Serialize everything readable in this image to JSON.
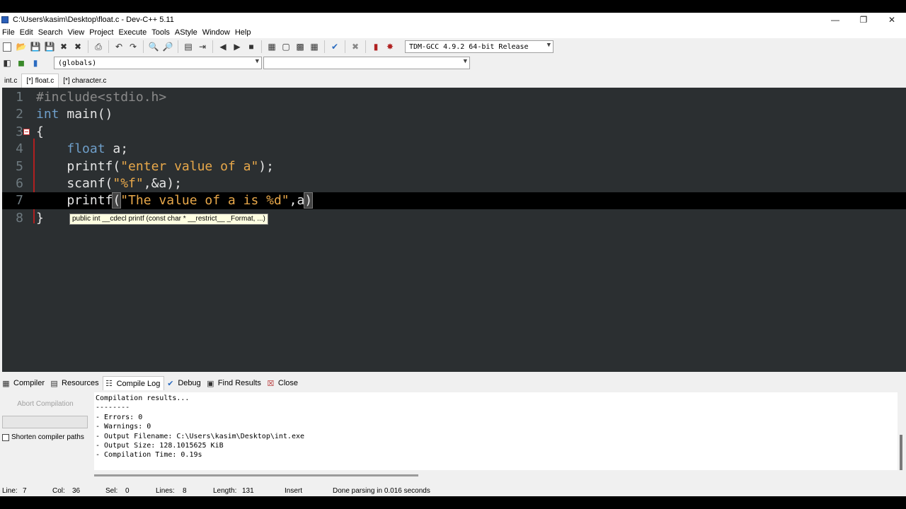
{
  "window": {
    "title": "C:\\Users\\kasim\\Desktop\\float.c - Dev-C++ 5.11",
    "controls": [
      "minimize",
      "restore",
      "close"
    ]
  },
  "menu": [
    "File",
    "Edit",
    "Search",
    "View",
    "Project",
    "Execute",
    "Tools",
    "AStyle",
    "Window",
    "Help"
  ],
  "toolbar": {
    "compiler_select": "TDM-GCC 4.9.2 64-bit Release",
    "scope_select": "(globals)",
    "function_select": ""
  },
  "tabs": [
    "int.c",
    "[*] float.c",
    "[*] character.c"
  ],
  "active_tab": "[*] float.c",
  "editor": {
    "lines": [
      {
        "n": "1",
        "parts": [
          {
            "t": "#include<stdio.h>",
            "c": "pp"
          }
        ]
      },
      {
        "n": "2",
        "parts": [
          {
            "t": "int",
            "c": "kw"
          },
          {
            "t": " main()",
            "c": ""
          }
        ]
      },
      {
        "n": "3",
        "parts": [
          {
            "t": "{",
            "c": ""
          }
        ]
      },
      {
        "n": "4",
        "parts": [
          {
            "t": "    ",
            "c": ""
          },
          {
            "t": "float",
            "c": "kw"
          },
          {
            "t": " a;",
            "c": ""
          }
        ]
      },
      {
        "n": "5",
        "parts": [
          {
            "t": "    printf(",
            "c": ""
          },
          {
            "t": "\"enter value of a\"",
            "c": "str"
          },
          {
            "t": ");",
            "c": ""
          }
        ]
      },
      {
        "n": "6",
        "parts": [
          {
            "t": "    scanf(",
            "c": ""
          },
          {
            "t": "\"%f\"",
            "c": "str"
          },
          {
            "t": ",&a);",
            "c": ""
          }
        ]
      },
      {
        "n": "7",
        "parts": [
          {
            "t": "    printf",
            "c": ""
          },
          {
            "t": "(",
            "c": "hl"
          },
          {
            "t": "\"The value of a is %d\"",
            "c": "str"
          },
          {
            "t": ",a",
            "c": ""
          },
          {
            "t": ")",
            "c": "hl"
          }
        ]
      },
      {
        "n": "8",
        "parts": [
          {
            "t": "}",
            "c": ""
          }
        ]
      }
    ],
    "current_line": "7",
    "tooltip": "public int __cdecl printf (const char * __restrict__ _Format, ...)"
  },
  "bottom_tabs": [
    {
      "label": "Compiler",
      "icon": "grid-icon"
    },
    {
      "label": "Resources",
      "icon": "resources-icon"
    },
    {
      "label": "Compile Log",
      "icon": "chart-icon"
    },
    {
      "label": "Debug",
      "icon": "check-icon"
    },
    {
      "label": "Find Results",
      "icon": "find-icon"
    },
    {
      "label": "Close",
      "icon": "close-icon"
    }
  ],
  "active_bottom_tab": "Compile Log",
  "compile_panel": {
    "abort_label": "Abort Compilation",
    "shorten_label": "Shorten compiler paths",
    "log": [
      "Compilation results...",
      "--------",
      "- Errors: 0",
      "- Warnings: 0",
      "- Output Filename: C:\\Users\\kasim\\Desktop\\int.exe",
      "- Output Size: 128.1015625 KiB",
      "- Compilation Time: 0.19s"
    ]
  },
  "status": {
    "line_label": "Line:",
    "line_value": "7",
    "col_label": "Col:",
    "col_value": "36",
    "sel_label": "Sel:",
    "sel_value": "0",
    "lines_label": "Lines:",
    "lines_value": "8",
    "length_label": "Length:",
    "length_value": "131",
    "mode": "Insert",
    "message": "Done parsing in 0.016 seconds"
  }
}
